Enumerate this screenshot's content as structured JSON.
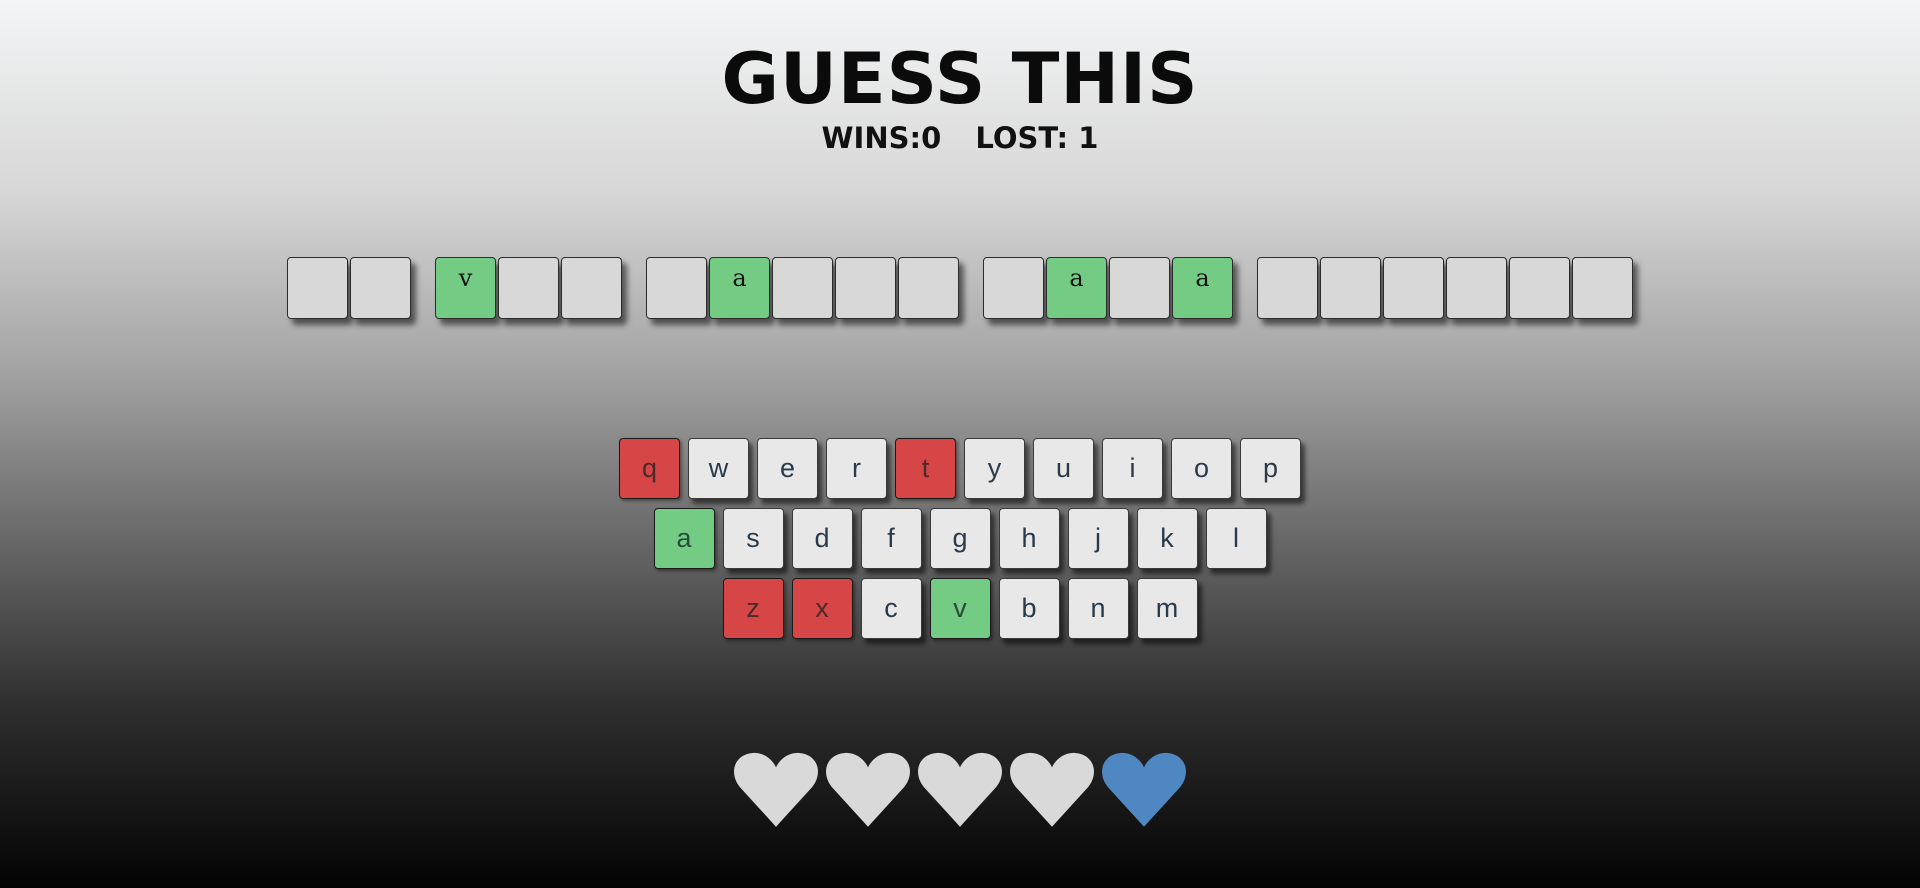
{
  "title": "GUESS THIS",
  "score": {
    "wins": "WINS:0",
    "lost": "LOST: 1"
  },
  "word": [
    [
      "",
      ""
    ],
    [
      "v",
      "",
      ""
    ],
    [
      "",
      "a",
      "",
      "",
      ""
    ],
    [
      "",
      "a",
      "",
      "a"
    ],
    [
      "",
      "",
      "",
      "",
      "",
      ""
    ]
  ],
  "keyboard": [
    [
      {
        "letter": "q",
        "state": "wrong"
      },
      {
        "letter": "w",
        "state": "unused"
      },
      {
        "letter": "e",
        "state": "unused"
      },
      {
        "letter": "r",
        "state": "unused"
      },
      {
        "letter": "t",
        "state": "wrong"
      },
      {
        "letter": "y",
        "state": "unused"
      },
      {
        "letter": "u",
        "state": "unused"
      },
      {
        "letter": "i",
        "state": "unused"
      },
      {
        "letter": "o",
        "state": "unused"
      },
      {
        "letter": "p",
        "state": "unused"
      }
    ],
    [
      {
        "letter": "a",
        "state": "correct"
      },
      {
        "letter": "s",
        "state": "unused"
      },
      {
        "letter": "d",
        "state": "unused"
      },
      {
        "letter": "f",
        "state": "unused"
      },
      {
        "letter": "g",
        "state": "unused"
      },
      {
        "letter": "h",
        "state": "unused"
      },
      {
        "letter": "j",
        "state": "unused"
      },
      {
        "letter": "k",
        "state": "unused"
      },
      {
        "letter": "l",
        "state": "unused"
      }
    ],
    [
      {
        "letter": "z",
        "state": "wrong"
      },
      {
        "letter": "x",
        "state": "wrong"
      },
      {
        "letter": "c",
        "state": "unused"
      },
      {
        "letter": "v",
        "state": "correct"
      },
      {
        "letter": "b",
        "state": "unused"
      },
      {
        "letter": "n",
        "state": "unused"
      },
      {
        "letter": "m",
        "state": "unused"
      }
    ]
  ],
  "lives": {
    "total": 5,
    "remaining": 1,
    "lost_color": "#d9d9d9",
    "remaining_color": "#4f87c2",
    "icon": "heart-icon"
  },
  "colors": {
    "revealed_tile": "#74cc84",
    "wrong_key": "#d64646",
    "correct_key": "#74cc84",
    "unused_key": "#e8e8e8"
  }
}
